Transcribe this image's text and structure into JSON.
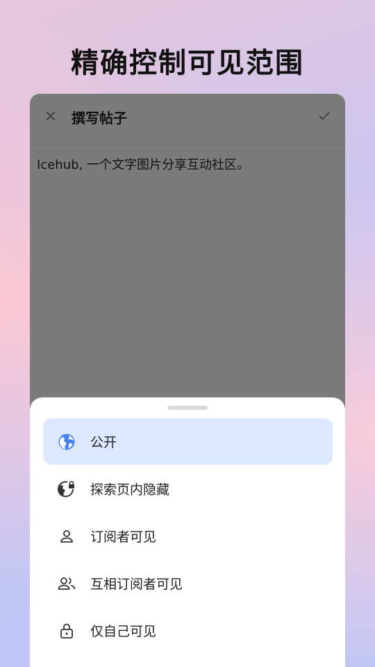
{
  "headline": "精确控制可见范围",
  "compose": {
    "title": "撰写帖子",
    "close_icon": "close-icon",
    "confirm_icon": "check-icon",
    "body_text": "Icehub, 一个文字图片分享互动社区。"
  },
  "visibility_sheet": {
    "options": [
      {
        "label": "公开",
        "icon": "globe-icon",
        "selected": true
      },
      {
        "label": "探索页内隐藏",
        "icon": "globe-lock-icon",
        "selected": false
      },
      {
        "label": "订阅者可见",
        "icon": "person-icon",
        "selected": false
      },
      {
        "label": "互相订阅者可见",
        "icon": "people-icon",
        "selected": false
      },
      {
        "label": "仅自己可见",
        "icon": "lock-icon",
        "selected": false
      }
    ]
  },
  "colors": {
    "accent": "#4a82f0",
    "selected_bg": "#dce8fd",
    "overlay": "#7b7b7b"
  }
}
